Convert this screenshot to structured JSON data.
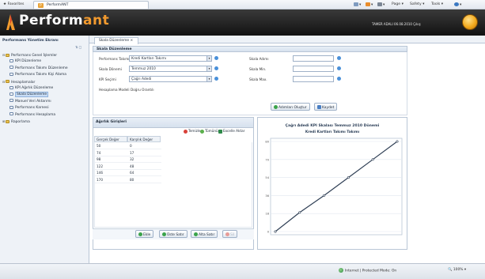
{
  "browser": {
    "favorites_label": "Favorites",
    "tab_title": "PerformANT",
    "commands": [
      "Page ▾",
      "Safety ▾",
      "Tools ▾"
    ]
  },
  "app": {
    "brand_main": "Perform",
    "brand_accent": "ant",
    "user_info": "TAMER ADALI 06.08.2010 Çıkış"
  },
  "sidebar": {
    "title": "Performans Yönetim Ekranı",
    "items": [
      {
        "label": "Performans Genel İşlemler",
        "kind": "folder",
        "level": 0,
        "expanded": true
      },
      {
        "label": "KPI Düzenleme",
        "kind": "page",
        "level": 1
      },
      {
        "label": "Performans Takımı Düzenleme",
        "kind": "page",
        "level": 1
      },
      {
        "label": "Performans Takımı Kişi Atama",
        "kind": "page",
        "level": 1
      },
      {
        "label": "Hesaplamalar",
        "kind": "folder",
        "level": 0,
        "expanded": true
      },
      {
        "label": "KPI Ağırlık Düzenleme",
        "kind": "page",
        "level": 1
      },
      {
        "label": "Skala Düzenleme",
        "kind": "page",
        "level": 1,
        "selected": true
      },
      {
        "label": "Manuel Veri Aktarımı",
        "kind": "page",
        "level": 1
      },
      {
        "label": "Performans Karnesi",
        "kind": "page",
        "level": 1
      },
      {
        "label": "Performans Hesaplama",
        "kind": "page",
        "level": 1
      },
      {
        "label": "Raporlama",
        "kind": "folder",
        "level": 0,
        "expanded": false
      }
    ]
  },
  "main": {
    "tab_label": "Skala Düzenleme ×",
    "section_title": "Skala Düzenleme",
    "form": {
      "team_label": "Performans Takımı",
      "team_value": "Kredi Kartları Takımı",
      "period_label": "Skala Dönemi",
      "period_value": "Temmuz 2010",
      "kpi_label": "KPI Seçimi",
      "kpi_value": "Çağrı Adedi",
      "model_label": "Hesaplama Modeli",
      "model_value": "Doğru Orantılı",
      "step_label": "Skala Adımı",
      "min_label": "Skala Min.",
      "max_label": "Skala Max.",
      "create_steps_button": "Adımları Oluştur",
      "save_button": "Kaydet"
    },
    "grid": {
      "title": "Ağırlık Girişleri",
      "actions": [
        "Temizle",
        "Tümünü",
        "Excelle Aktar"
      ],
      "columns": [
        "Gerçek Değer",
        "Karşılık Değer"
      ],
      "rows": [
        [
          "50",
          "0"
        ],
        [
          "74",
          "17"
        ],
        [
          "98",
          "32"
        ],
        [
          "122",
          "48"
        ],
        [
          "146",
          "64"
        ],
        [
          "170",
          "80"
        ]
      ],
      "footer_buttons": [
        "Ekle",
        "Üste Satır",
        "Alta Satır",
        "Sil"
      ]
    }
  },
  "chart_data": {
    "type": "line",
    "title": "Çağrı Adedi KPI Skalası Temmuz 2010 Dönemi",
    "subtitle": "Kredi Kartları Takımı Takımı",
    "x": [
      50,
      74,
      98,
      122,
      146,
      170
    ],
    "y": [
      0,
      17,
      32,
      48,
      64,
      80
    ],
    "ylim": [
      0,
      80
    ],
    "y_ticks": [
      "80",
      "70",
      "54",
      "36",
      "18",
      "0"
    ],
    "grid": true,
    "color": "#2f3f55"
  },
  "status": {
    "zone": "Internet | Protected Mode: On",
    "zoom": "100%"
  }
}
